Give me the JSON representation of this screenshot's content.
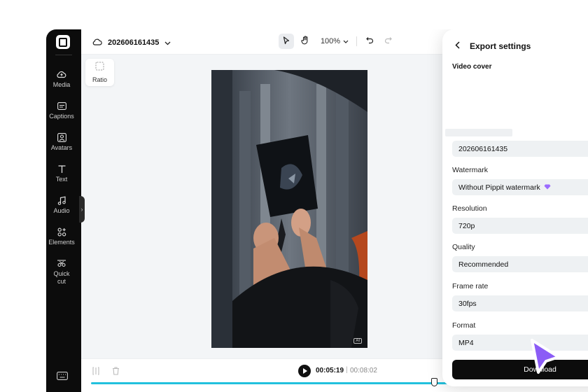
{
  "project": {
    "name": "202606161435"
  },
  "sidebar": {
    "items": [
      {
        "label": "Media"
      },
      {
        "label": "Captions"
      },
      {
        "label": "Avatars"
      },
      {
        "label": "Text"
      },
      {
        "label": "Audio"
      },
      {
        "label": "Elements"
      },
      {
        "label": "Quick cut"
      }
    ]
  },
  "toolbar": {
    "zoom": "100%"
  },
  "canvas": {
    "ratio_label": "Ratio",
    "ai_badge": "AI"
  },
  "player": {
    "current_time": "00:05:19",
    "separator": "|",
    "total_time": "00:08:02"
  },
  "export": {
    "title": "Export settings",
    "cover_label": "Video cover",
    "name_value": "202606161435",
    "watermark": {
      "label": "Watermark",
      "value": "Without Pippit watermark"
    },
    "resolution": {
      "label": "Resolution",
      "value": "720p"
    },
    "quality": {
      "label": "Quality",
      "value": "Recommended"
    },
    "frame_rate": {
      "label": "Frame rate",
      "value": "30fps"
    },
    "format": {
      "label": "Format",
      "value": "MP4"
    },
    "download_label": "Download"
  },
  "colors": {
    "accent_progress": "#22c1dd",
    "cursor": "#8b5cf6",
    "gem": "#9b6bff",
    "sidebar_bg": "#0c0c0c"
  }
}
